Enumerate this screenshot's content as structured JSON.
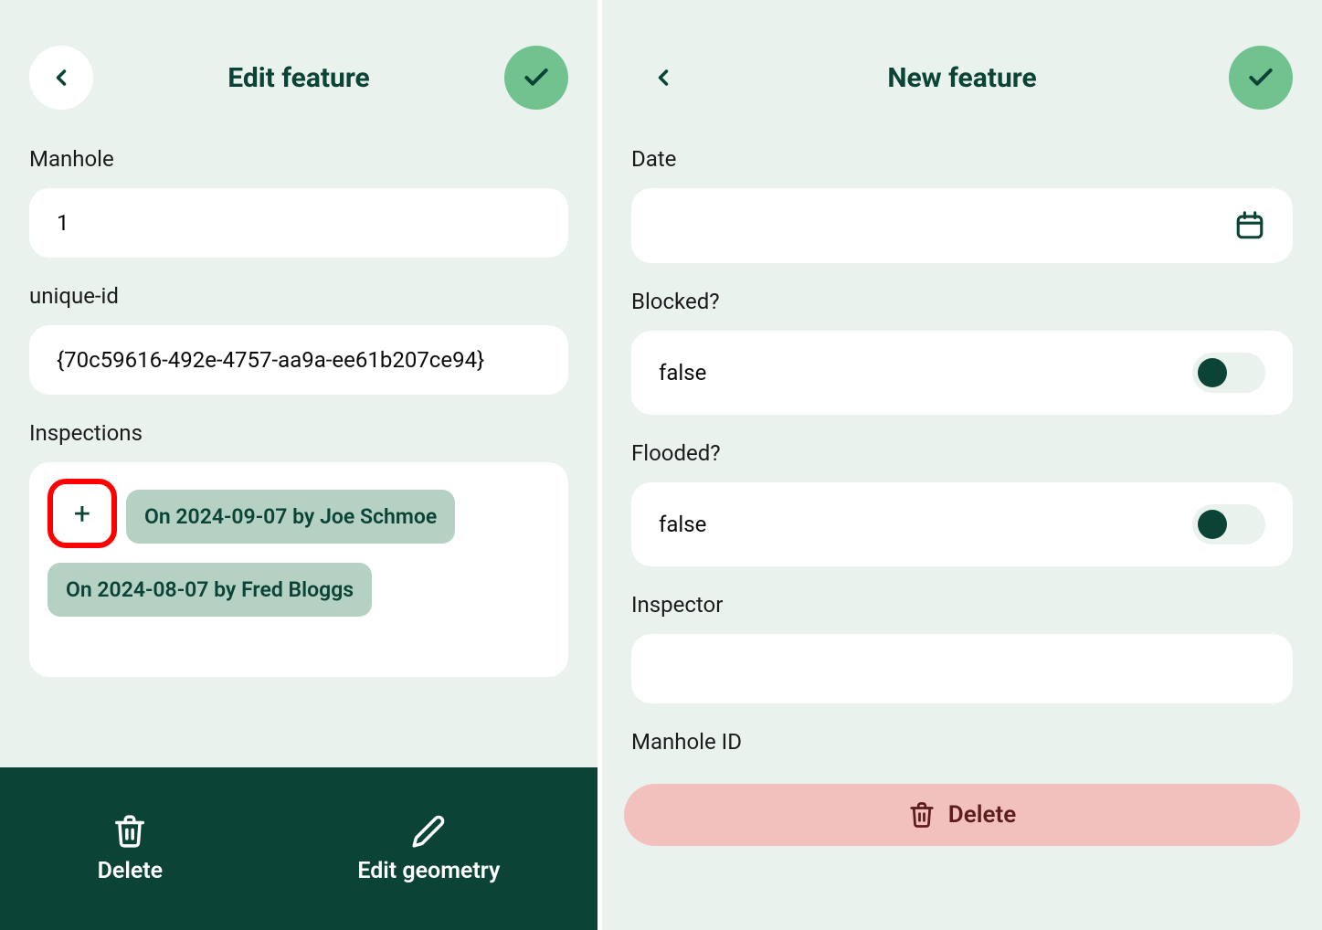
{
  "left": {
    "header_title": "Edit feature",
    "fields": {
      "manhole_label": "Manhole",
      "manhole_value": "1",
      "uniqueid_label": "unique-id",
      "uniqueid_value": "{70c59616-492e-4757-aa9a-ee61b207ce94}",
      "inspections_label": "Inspections",
      "inspections": [
        "On 2024-09-07 by Joe Schmoe",
        "On 2024-08-07 by Fred Bloggs"
      ]
    },
    "bottom": {
      "delete_label": "Delete",
      "edit_geometry_label": "Edit geometry"
    }
  },
  "right": {
    "header_title": "New feature",
    "fields": {
      "date_label": "Date",
      "date_value": "",
      "blocked_label": "Blocked?",
      "blocked_value": "false",
      "flooded_label": "Flooded?",
      "flooded_value": "false",
      "inspector_label": "Inspector",
      "inspector_value": "",
      "manholeid_label": "Manhole ID"
    },
    "bottom": {
      "delete_label": "Delete"
    }
  },
  "icons": {
    "plus": "+"
  }
}
